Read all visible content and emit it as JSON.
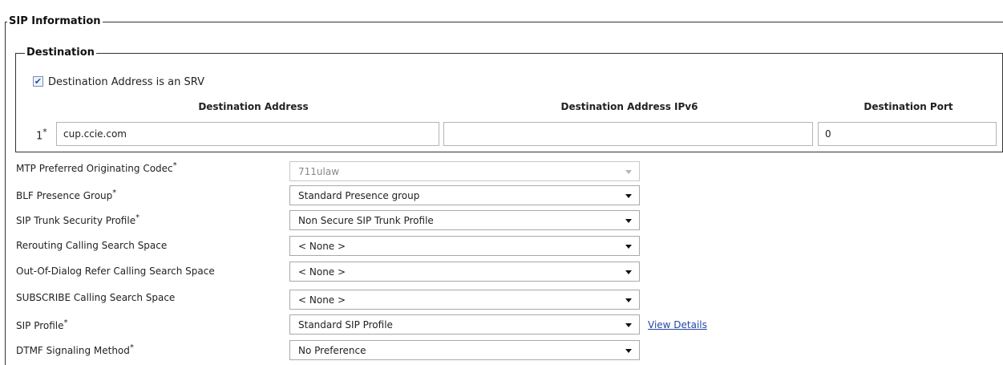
{
  "sip_information": {
    "title": "SIP Information",
    "destination": {
      "title": "Destination",
      "srv_checkbox": {
        "label": "Destination Address is an SRV",
        "checked": true
      },
      "columns": [
        "Destination Address",
        "Destination Address IPv6",
        "Destination Port"
      ],
      "rows": [
        {
          "index": "1",
          "required": "*",
          "address": "cup.ccie.com",
          "address_ipv6": "",
          "port": "0"
        }
      ]
    },
    "fields": [
      {
        "label": "MTP Preferred Originating Codec",
        "required": "*",
        "value": "711ulaw",
        "disabled": true
      },
      {
        "label": "BLF Presence Group",
        "required": "*",
        "value": "Standard Presence group"
      },
      {
        "label": "SIP Trunk Security Profile",
        "required": "*",
        "value": "Non Secure SIP Trunk Profile"
      },
      {
        "label": "Rerouting Calling Search Space",
        "required": "",
        "value": "< None >"
      },
      {
        "label": "Out-Of-Dialog Refer Calling Search Space",
        "required": "",
        "value": "< None >"
      },
      {
        "label": "SUBSCRIBE Calling Search Space",
        "required": "",
        "value": "< None >"
      },
      {
        "label": "SIP Profile",
        "required": "*",
        "value": "Standard SIP Profile",
        "link": "View Details"
      },
      {
        "label": "DTMF Signaling Method",
        "required": "*",
        "value": "No Preference"
      }
    ]
  }
}
